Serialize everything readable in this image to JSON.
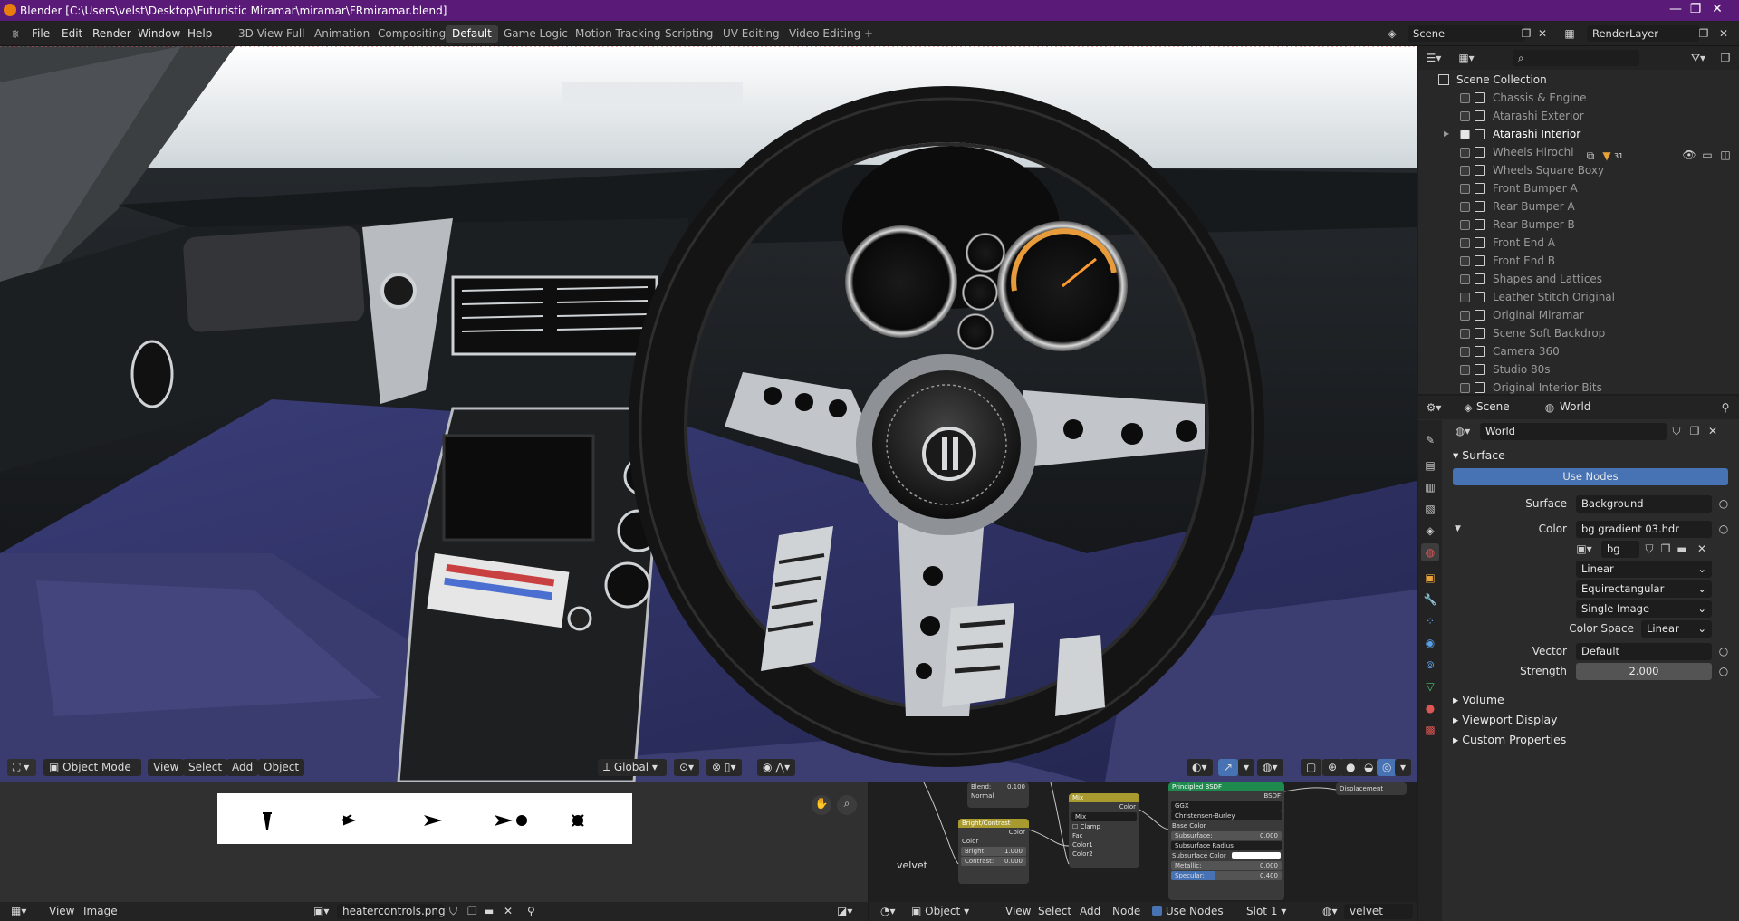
{
  "window": {
    "title": "Blender [C:\\Users\\velst\\Desktop\\Futuristic Miramar\\miramar\\FRmiramar.blend]",
    "controls": [
      "—",
      "❐",
      "✕"
    ]
  },
  "menu": [
    "File",
    "Edit",
    "Render",
    "Window",
    "Help"
  ],
  "workspaces": [
    {
      "label": "3D View Full",
      "active": false
    },
    {
      "label": "Animation",
      "active": false
    },
    {
      "label": "Compositing",
      "active": false
    },
    {
      "label": "Default",
      "active": true
    },
    {
      "label": "Game Logic",
      "active": false
    },
    {
      "label": "Motion Tracking",
      "active": false
    },
    {
      "label": "Scripting",
      "active": false
    },
    {
      "label": "UV Editing",
      "active": false
    },
    {
      "label": "Video Editing",
      "active": false
    }
  ],
  "add_workspace": "+",
  "scene": {
    "name": "Scene"
  },
  "view_layer": {
    "name": "RenderLayer"
  },
  "viewport": {
    "mode": "Object Mode",
    "menus": [
      "View",
      "Select",
      "Add",
      "Object"
    ],
    "transform": "Global"
  },
  "outliner": {
    "root": "Scene Collection",
    "items": [
      {
        "label": "Chassis & Engine",
        "checked": false,
        "active": false
      },
      {
        "label": "Atarashi Exterior",
        "checked": false,
        "active": false
      },
      {
        "label": "Atarashi Interior",
        "checked": true,
        "active": true
      },
      {
        "label": "Wheels Hirochi",
        "checked": false,
        "active": false
      },
      {
        "label": "Wheels Square Boxy",
        "checked": false,
        "active": false
      },
      {
        "label": "Front Bumper A",
        "checked": false,
        "active": false
      },
      {
        "label": "Rear Bumper A",
        "checked": false,
        "active": false
      },
      {
        "label": "Rear Bumper B",
        "checked": false,
        "active": false
      },
      {
        "label": "Front End A",
        "checked": false,
        "active": false
      },
      {
        "label": "Front End B",
        "checked": false,
        "active": false
      },
      {
        "label": "Shapes and Lattices",
        "checked": false,
        "active": false
      },
      {
        "label": "Leather Stitch Original",
        "checked": false,
        "active": false
      },
      {
        "label": "Original Miramar",
        "checked": false,
        "active": false
      },
      {
        "label": "Scene Soft Backdrop",
        "checked": false,
        "active": false
      },
      {
        "label": "Camera 360",
        "checked": false,
        "active": false
      },
      {
        "label": "Studio 80s",
        "checked": false,
        "active": false
      },
      {
        "label": "Original Interior Bits",
        "checked": false,
        "active": false
      }
    ],
    "active_badge": "31"
  },
  "properties": {
    "breadcrumb_scene": "Scene",
    "breadcrumb_world": "World",
    "world_name": "World",
    "surface_panel": "Surface",
    "use_nodes": "Use Nodes",
    "surface_label": "Surface",
    "surface_value": "Background",
    "color_label": "Color",
    "color_value": "bg gradient 03.hdr",
    "image_short": "bg gr",
    "interpolation": "Linear",
    "projection": "Equirectangular",
    "source": "Single Image",
    "color_space_label": "Color Space",
    "color_space_value": "Linear",
    "vector_label": "Vector",
    "vector_value": "Default",
    "strength_label": "Strength",
    "strength_value": "2.000",
    "panels": [
      "Volume",
      "Viewport Display",
      "Custom Properties"
    ]
  },
  "image_editor": {
    "menus": [
      "View",
      "Image"
    ],
    "image_name": "heatercontrols.png"
  },
  "node_editor": {
    "object": "Object",
    "menus": [
      "View",
      "Select",
      "Add",
      "Node"
    ],
    "use_nodes": "Use Nodes",
    "slot": "Slot 1",
    "material": "velvet",
    "node_label": "velvet",
    "nodes": {
      "mix1": {
        "blend": "Blend:",
        "blend_val": "0.100",
        "normal": "Normal"
      },
      "bc": {
        "title": "Bright/Contrast",
        "color": "Color",
        "color_in": "Color",
        "bright": "Bright:",
        "bright_val": "1.000",
        "contrast": "Contrast:",
        "contrast_val": "0.000"
      },
      "mix2": {
        "title": "Mix",
        "color": "Color",
        "mode": "Mix",
        "clamp": "Clamp",
        "fac": "Fac",
        "c1": "Color1",
        "c2": "Color2"
      },
      "bsdf": {
        "title": "Principled BSDF",
        "sub": "BSDF",
        "dist": "GGX",
        "sss": "Christensen-Burley",
        "base": "Base Color",
        "subsurface": "Subsurface:",
        "subsurface_val": "0.000",
        "radius": "Subsurface Radius",
        "sscolor": "Subsurface Color",
        "metallic": "Metallic:",
        "metallic_val": "0.000",
        "specular": "Specular:",
        "specular_val": "0.400"
      },
      "disp": {
        "title": "Displacement"
      },
      "bottom": {
        "color": "Color"
      }
    }
  },
  "colors": {
    "titlebar": "#5a1a78",
    "accent_blue": "#4772b3",
    "bsdf_header": "#1f8a4d",
    "mix_header": "#a89a2e",
    "bc_header": "#a89a2e"
  }
}
